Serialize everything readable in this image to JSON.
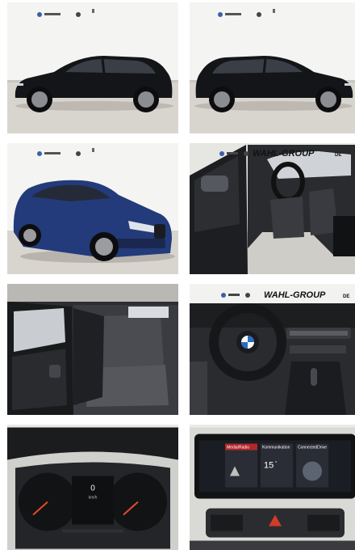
{
  "gallery": {
    "photos": [
      {
        "subject": "black BMW 1 Series hatchback, side view facing left"
      },
      {
        "subject": "black BMW 1 Series hatchback, side view facing right"
      },
      {
        "subject": "blue BMW 1 Series hatchback, front three-quarter view"
      },
      {
        "subject": "driver door open, front seats"
      },
      {
        "subject": "rear door open, rear seats"
      },
      {
        "subject": "cockpit with steering wheel and center console"
      },
      {
        "subject": "instrument cluster close-up"
      },
      {
        "subject": "infotainment screen close-up"
      }
    ],
    "dealer_overlay": "WAHL-GROUP",
    "dealer_overlay_suffix": "DE",
    "screen": {
      "tile_left": "Media/Radio",
      "tile_mid": "Kommunikation",
      "tile_right": "ConnectedDrive",
      "temperature": "15",
      "temperature_unit": "°"
    },
    "cluster": {
      "speed_readout": "0",
      "unit": "km/h"
    },
    "colors": {
      "car_black": "#141518",
      "car_blue": "#233b7a",
      "floor": "#d9d6d0",
      "wall": "#f4f4f2",
      "interior": "#2a2b2e"
    }
  }
}
